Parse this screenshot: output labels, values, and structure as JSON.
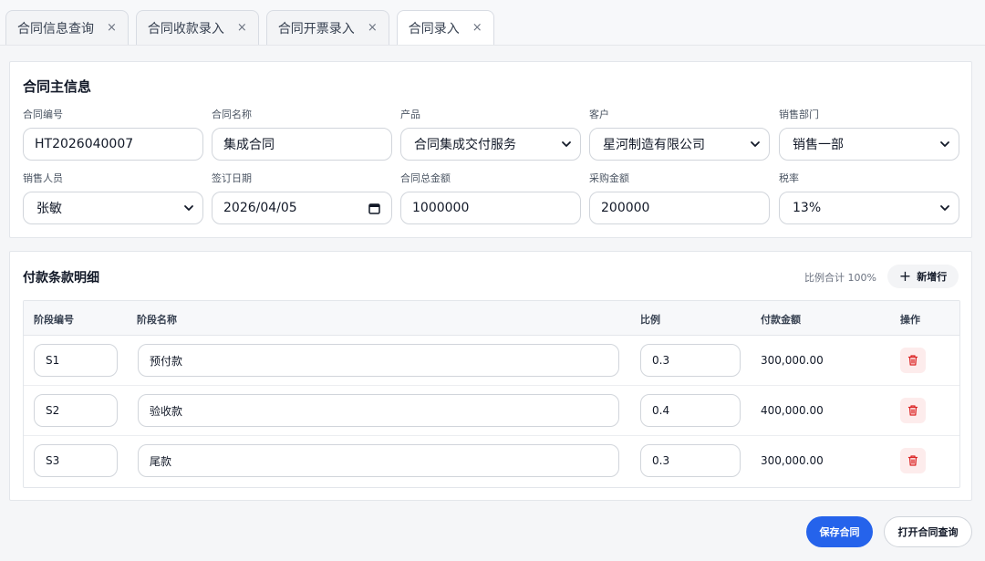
{
  "tabs": [
    {
      "label": "合同信息查询",
      "close": "×"
    },
    {
      "label": "合同收款录入",
      "close": "×"
    },
    {
      "label": "合同开票录入",
      "close": "×"
    },
    {
      "label": "合同录入",
      "close": "×",
      "active": true
    }
  ],
  "main_info": {
    "title": "合同主信息",
    "fields": {
      "contract_no": {
        "label": "合同编号",
        "value": "HT2026040007"
      },
      "contract_name": {
        "label": "合同名称",
        "value": "集成合同"
      },
      "product": {
        "label": "产品",
        "value": "合同集成交付服务"
      },
      "customer": {
        "label": "客户",
        "value": "星河制造有限公司"
      },
      "sales_dept": {
        "label": "销售部门",
        "value": "销售一部"
      },
      "salesperson": {
        "label": "销售人员",
        "value": "张敏"
      },
      "sign_date": {
        "label": "签订日期",
        "value": "2026/04/05"
      },
      "total_amount": {
        "label": "合同总金额",
        "value": "1000000"
      },
      "purchase_amount": {
        "label": "采购金额",
        "value": "200000"
      },
      "tax_rate": {
        "label": "税率",
        "value": "13%"
      }
    }
  },
  "payment_terms": {
    "title": "付款条款明细",
    "ratio_sum": "比例合计 100%",
    "add_row_label": "新增行",
    "headers": {
      "stage_no": "阶段编号",
      "stage_name": "阶段名称",
      "ratio": "比例",
      "amount": "付款金额",
      "actions": "操作"
    },
    "rows": [
      {
        "stage_no": "S1",
        "stage_name": "预付款",
        "ratio": "0.3",
        "amount": "300,000.00"
      },
      {
        "stage_no": "S2",
        "stage_name": "验收款",
        "ratio": "0.4",
        "amount": "400,000.00"
      },
      {
        "stage_no": "S3",
        "stage_name": "尾款",
        "ratio": "0.3",
        "amount": "300,000.00"
      }
    ]
  },
  "footer": {
    "save_label": "保存合同",
    "open_label": "打开合同查询"
  },
  "colors": {
    "primary": "#2563eb",
    "delete_icon": "#dc2626",
    "delete_bg": "#fdecec"
  }
}
